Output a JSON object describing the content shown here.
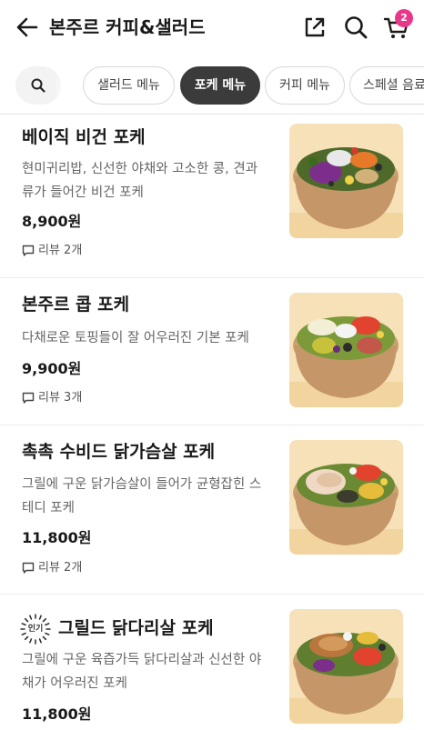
{
  "header": {
    "title": "본주르 커피&샐러드",
    "cart_count": "2"
  },
  "tabs": [
    {
      "label": "샐러드 메뉴",
      "active": false
    },
    {
      "label": "포케 메뉴",
      "active": true
    },
    {
      "label": "커피 메뉴",
      "active": false
    },
    {
      "label": "스페셜 음료",
      "active": false
    }
  ],
  "items": [
    {
      "name": "베이직 비건 포케",
      "desc": "현미귀리밥, 신선한 야채와 고소한 콩, 견과류가 들어간 비건 포케",
      "price": "8,900원",
      "review": "리뷰 2개"
    },
    {
      "name": "본주르 콥 포케",
      "desc": "다채로운 토핑들이 잘 어우러진 기본 포케",
      "price": "9,900원",
      "review": "리뷰 3개"
    },
    {
      "name": "촉촉 수비드 닭가슴살 포케",
      "desc": "그릴에 구운 닭가슴살이 들어가 균형잡힌 스테디 포케",
      "price": "11,800원",
      "review": "리뷰 2개"
    },
    {
      "name": "그릴드 닭다리살 포케",
      "badge": "인기",
      "desc": "그릴에 구운 육즙가득 닭다리살과 신선한 야채가 어우러진 포케",
      "price": "11,800원"
    }
  ],
  "colors": {
    "accent": "#e8388a",
    "active_tab": "#3b3b3b"
  }
}
